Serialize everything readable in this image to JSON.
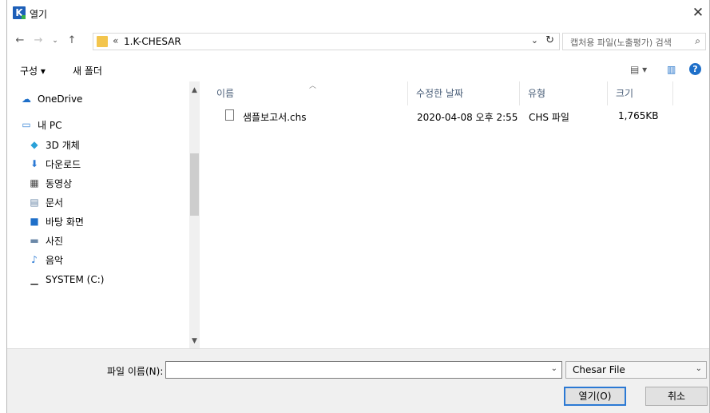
{
  "window": {
    "title": "열기"
  },
  "address": {
    "separator": "«",
    "path": "1.K-CHESAR"
  },
  "search": {
    "placeholder": "캡처용 파일(노출평가) 검색"
  },
  "toolbar": {
    "organize": "구성 ▾",
    "new_folder": "새 폴더"
  },
  "nav": {
    "onedrive": "OneDrive",
    "this_pc": "내 PC",
    "items": [
      "3D 개체",
      "다운로드",
      "동영상",
      "문서",
      "바탕 화면",
      "사진",
      "음악",
      "SYSTEM (C:)"
    ]
  },
  "columns": {
    "name": "이름",
    "modified": "수정한 날짜",
    "type": "유형",
    "size": "크기"
  },
  "files": [
    {
      "name": "샘플보고서.chs",
      "modified": "2020-04-08 오후 2:55",
      "type": "CHS 파일",
      "size": "1,765KB"
    }
  ],
  "footer": {
    "filename_label": "파일 이름(N):",
    "filename_value": "",
    "filetype": "Chesar File",
    "open": "열기(O)",
    "cancel": "취소"
  },
  "colors": {
    "accent": "#2b79d4",
    "folder": "#f3c54d",
    "header_text": "#4c607a"
  }
}
